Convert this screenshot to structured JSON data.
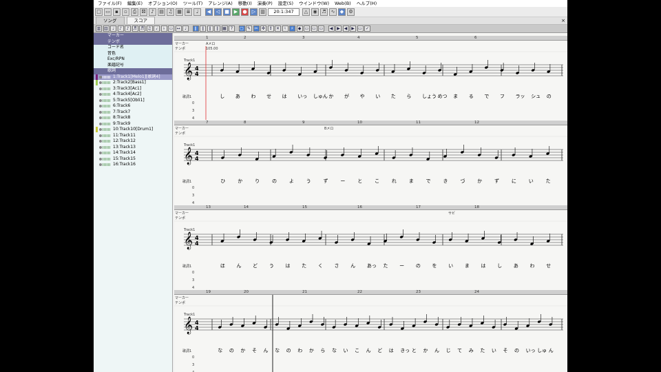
{
  "menu": [
    "ファイル(F)",
    "編集(E)",
    "オプション(O)",
    "ツール(T)",
    "アレンジ(A)",
    "移動(I)",
    "演奏(P)",
    "設定(S)",
    "ウインドウ(W)",
    "Web(B)",
    "ヘルプ(H)"
  ],
  "toolbar": {
    "position": "20:1:347"
  },
  "tabs": [
    "ソング",
    "スコア"
  ],
  "tab_close": "×",
  "track_meta": [
    "マーカー",
    "テンポ",
    "コード名",
    "音色",
    "Exc/RPN",
    "楽譜記号",
    "歌詞"
  ],
  "tracks": [
    {
      "label": "1:Track1[Melo1][歌詞4]",
      "selected": true,
      "color": "#7a1f7a"
    },
    {
      "label": "2:Track2[Bass1]",
      "selected": false,
      "color": "#9fcc55"
    },
    {
      "label": "3:Track3[Ac1]",
      "selected": false,
      "color": ""
    },
    {
      "label": "4:Track4[Ac2]",
      "selected": false,
      "color": ""
    },
    {
      "label": "5:Track5[Obli1]",
      "selected": false,
      "color": ""
    },
    {
      "label": "6:Track6",
      "selected": false,
      "color": ""
    },
    {
      "label": "7:Track7",
      "selected": false,
      "color": ""
    },
    {
      "label": "8:Track8",
      "selected": false,
      "color": ""
    },
    {
      "label": "9:Track9",
      "selected": false,
      "color": ""
    },
    {
      "label": "10:Track10[Drum1]",
      "selected": false,
      "color": "#c8c838"
    },
    {
      "label": "11:Track11",
      "selected": false,
      "color": ""
    },
    {
      "label": "12:Track12",
      "selected": false,
      "color": ""
    },
    {
      "label": "13:Track13",
      "selected": false,
      "color": ""
    },
    {
      "label": "14:Track14",
      "selected": false,
      "color": ""
    },
    {
      "label": "15:Track15",
      "selected": false,
      "color": ""
    },
    {
      "label": "16:Track16",
      "selected": false,
      "color": ""
    }
  ],
  "score": {
    "marker_label": "マーカー",
    "tempo_label": "テンポ",
    "track_name": "Track1",
    "lyric_label": "歌詞1",
    "lyric_sub": [
      "0",
      "3",
      "4"
    ],
    "systems": [
      {
        "measures": [
          "1",
          "2",
          "3",
          "4",
          "5",
          "6"
        ],
        "markers": [
          "Aメロ"
        ],
        "tempo": "105.00",
        "lyrics": [
          "し",
          "あ",
          "わ",
          "せ",
          "は",
          "いっ",
          "しゅん",
          "か",
          "が",
          "や",
          "い",
          "た",
          "ら",
          "しょう",
          "めつ",
          "ま",
          "る",
          "で",
          "フ",
          "ラッ",
          "シュ",
          "の"
        ]
      },
      {
        "measures": [
          "7",
          "8",
          "9",
          "10",
          "11",
          "12"
        ],
        "markers": [
          "Bメロ"
        ],
        "tempo": "",
        "lyrics": [
          "ひ",
          "か",
          "り",
          "の",
          "よ",
          "う",
          "ず",
          "ー",
          "と",
          "こ",
          "れ",
          "ま",
          "で",
          "き",
          "づ",
          "か",
          "ず",
          "に",
          "い",
          "た"
        ]
      },
      {
        "measures": [
          "13",
          "14",
          "15",
          "16",
          "17",
          "18"
        ],
        "markers": [
          "サビ"
        ],
        "tempo": "",
        "lyrics": [
          "ほ",
          "ん",
          "ど",
          "う",
          "は",
          "た",
          "く",
          "さ",
          "ん",
          "あっ",
          "た",
          "ー",
          "の",
          "を",
          "い",
          "ま",
          "は",
          "し",
          "あ",
          "わ",
          "せ"
        ]
      },
      {
        "measures": [
          "19",
          "20",
          "21",
          "22",
          "23",
          "24"
        ],
        "markers": [],
        "tempo": "",
        "lyrics": [
          "な",
          "の",
          "か",
          "そ",
          "ん",
          "な",
          "の",
          "わ",
          "か",
          "ら",
          "な",
          "い",
          "こ",
          "ん",
          "ど",
          "は",
          "きっ",
          "と",
          "か",
          "ん",
          "じ",
          "て",
          "み",
          "た",
          "い",
          "そ",
          "の",
          "いっ",
          "しゅ",
          "ん"
        ]
      }
    ]
  },
  "accent_color": "#4a7fd0"
}
